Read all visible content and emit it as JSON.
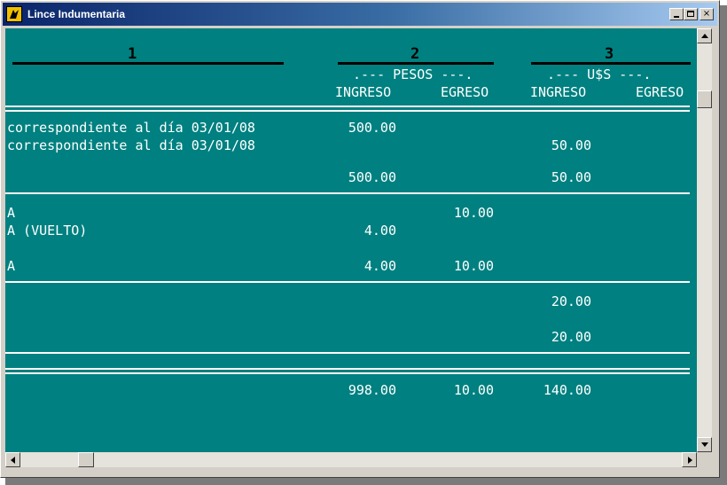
{
  "window": {
    "title": "Lince Indumentaria"
  },
  "titlebar_buttons": {
    "minimize": "",
    "maximize": "",
    "close": "×"
  },
  "header": {
    "col1": "1",
    "col2": "2",
    "col3": "3",
    "pesos_label": ".--- PESOS ---.",
    "usd_label": ".--- U$S ---.",
    "ingreso_pesos": "INGRESO",
    "egreso_pesos": "EGRESO",
    "ingreso_usd": "INGRESO",
    "egreso_usd": "EGRESO"
  },
  "rows": {
    "r1_desc": "correspondiente al día 03/01/08",
    "r1_ing_pesos": "500.00",
    "r2_desc": "correspondiente al día 03/01/08",
    "r2_ing_usd": "50.00",
    "sub1_ing_pesos": "500.00",
    "sub1_ing_usd": "50.00",
    "r3_desc": "A",
    "r3_egr_pesos": "10.00",
    "r4_desc": "A (VUELTO)",
    "r4_ing_pesos": "4.00",
    "sub2_desc": "A",
    "sub2_ing_pesos": "4.00",
    "sub2_egr_pesos": "10.00",
    "r5_ing_usd": "20.00",
    "sub3_ing_usd": "20.00"
  },
  "totals": {
    "ing_pesos": "998.00",
    "egr_pesos": "10.00",
    "ing_usd": "140.00"
  }
}
